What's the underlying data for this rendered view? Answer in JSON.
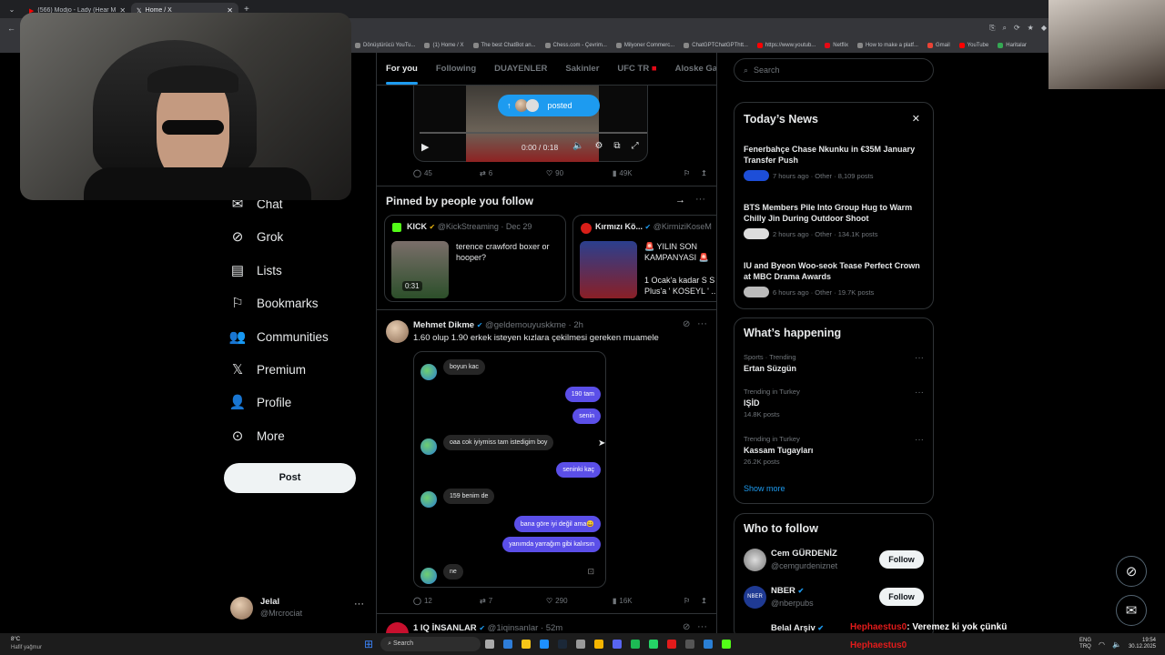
{
  "browser": {
    "tabs": [
      {
        "label": "(566) Modjo - Lady (Hear M"
      },
      {
        "label": "Home / X"
      }
    ],
    "bookmarks": [
      "Dönüştürücü YouTu...",
      "(1) Home / X",
      "The best ChatBot an...",
      "Chess.com - Çevrim...",
      "Milyoner Commerc...",
      "ChatGPTChatGPThtt...",
      "https://www.youtub...",
      "Netflix",
      "How to make a platf...",
      "Gmail",
      "YouTube",
      "Haritalar"
    ]
  },
  "sidebar": {
    "items": [
      {
        "label": "Chat",
        "icon": "chat-icon"
      },
      {
        "label": "Grok",
        "icon": "grok-icon"
      },
      {
        "label": "Lists",
        "icon": "lists-icon"
      },
      {
        "label": "Bookmarks",
        "icon": "bookmark-icon"
      },
      {
        "label": "Communities",
        "icon": "communities-icon"
      },
      {
        "label": "Premium",
        "icon": "x-logo-icon"
      },
      {
        "label": "Profile",
        "icon": "profile-icon"
      },
      {
        "label": "More",
        "icon": "more-icon"
      }
    ],
    "post_label": "Post",
    "account": {
      "name": "Jelal",
      "handle": "@Mrcrociat"
    }
  },
  "timeline": {
    "tabs": [
      "For you",
      "Following",
      "DUAYENLER",
      "Sakinler",
      "UFC TR",
      "Aloske Gang"
    ],
    "video": {
      "posted_label": "posted",
      "time": "0:00 / 0:18"
    },
    "post1_stats": {
      "replies": "45",
      "reposts": "6",
      "likes": "90",
      "views": "49K"
    },
    "pinned": {
      "title": "Pinned by people you follow",
      "cards": [
        {
          "name": "KICK",
          "handle": "@KickStreaming · Dec 29",
          "text": "terence crawford boxer or hooper?",
          "duration": "0:31"
        },
        {
          "name": "Kırmızı Kö...",
          "handle": "@KirmiziKoseM",
          "text1": "🚨 YILIN SON KAMPANYASI 🚨",
          "text2": "1 Ocak'a kadar S S Plus'a ' KOSEYL ' ..."
        }
      ]
    },
    "post2": {
      "name": "Mehmet Dikme",
      "handle": "@geldemouyuskkme · 2h",
      "text": "1.60 olup 1.90 erkek isteyen kızlara çekilmesi gereken muamele",
      "chat": [
        {
          "side": "left",
          "text": "boyun kac"
        },
        {
          "side": "right",
          "text": "190 tam"
        },
        {
          "side": "right",
          "text": "senin"
        },
        {
          "side": "left",
          "text": "oaa cok iyiymiss tam istedigim boy"
        },
        {
          "side": "right",
          "text": "seninki kaç"
        },
        {
          "side": "left",
          "text": "159 benim de"
        },
        {
          "side": "right",
          "text": "bana göre iyi değil ama😄"
        },
        {
          "side": "right",
          "text": "yanımda yarrağım gibi kalırsın"
        },
        {
          "side": "left",
          "text": "ne"
        }
      ],
      "stats": {
        "replies": "12",
        "reposts": "7",
        "likes": "290",
        "views": "16K"
      }
    },
    "post3": {
      "name": "1 IQ İNSANLAR",
      "handle": "@1iqinsanlar · 52m"
    }
  },
  "right": {
    "search_placeholder": "Search",
    "news": {
      "title": "Today’s News",
      "items": [
        {
          "title": "Fenerbahçe Chase Nkunku in €35M January Transfer Push",
          "meta": "7 hours ago · Other · 8,109 posts"
        },
        {
          "title": "BTS Members Pile Into Group Hug to Warm Chilly Jin During Outdoor Shoot",
          "meta": "2 hours ago · Other · 134.1K posts"
        },
        {
          "title": "IU and Byeon Woo-seok Tease Perfect Crown at MBC Drama Awards",
          "meta": "6 hours ago · Other · 19.7K posts"
        }
      ]
    },
    "happening": {
      "title": "What’s happening",
      "items": [
        {
          "context": "Sports · Trending",
          "topic": "Ertan Süzgün",
          "count": ""
        },
        {
          "context": "Trending in Turkey",
          "topic": "IŞİD",
          "count": "14.8K posts"
        },
        {
          "context": "Trending in Turkey",
          "topic": "Kassam Tugayları",
          "count": "26.2K posts"
        }
      ],
      "show_more": "Show more"
    },
    "who": {
      "title": "Who to follow",
      "items": [
        {
          "name": "Cem GÜRDENİZ",
          "handle": "@cemgurdeniznet",
          "btn": "Follow"
        },
        {
          "name": "NBER",
          "handle": "@nberpubs",
          "btn": "Follow"
        },
        {
          "name": "Belal Arşiv",
          "handle": ""
        }
      ]
    }
  },
  "overlay": {
    "chat1_user": "Hephaestus0",
    "chat1_msg": ": Veremez ki yok çünkü",
    "chat2_user": "Hephaestus0"
  },
  "taskbar": {
    "weather_temp": "8°C",
    "weather_desc": "Hafif yağmur",
    "search": "Search",
    "lang1": "ENG",
    "lang2": "TRQ",
    "time": "19:54",
    "date": "30.12.2025"
  },
  "colors": {
    "accent": "#1d9bf0",
    "bg": "#000000",
    "chat_purple": "#5b4fe8"
  }
}
